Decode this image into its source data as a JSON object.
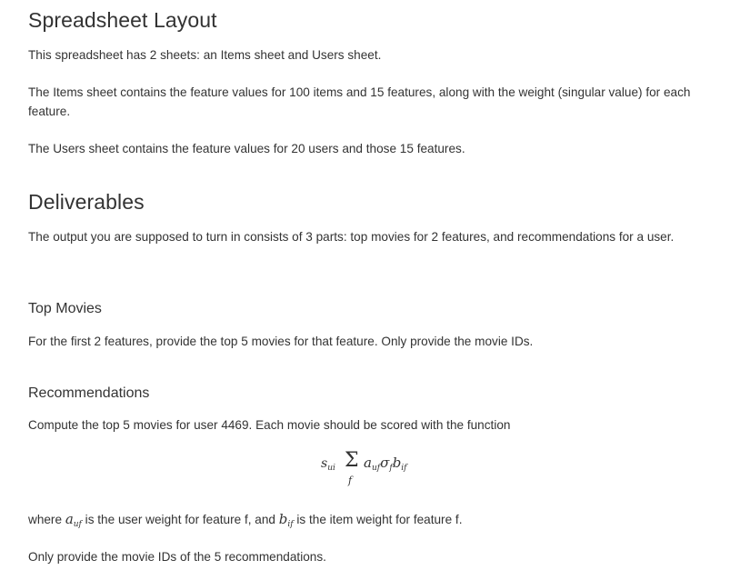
{
  "layout_section": {
    "heading": "Spreadsheet Layout",
    "para1": "This spreadsheet has 2 sheets: an Items sheet and Users sheet.",
    "para2": "The Items sheet contains the feature values for 100 items and 15 features, along with the weight (singular value) for each feature.",
    "para3": "The Users sheet contains the feature values for 20 users and those 15 features."
  },
  "deliverables_section": {
    "heading": "Deliverables",
    "para1": "The output you are supposed to turn in consists of 3 parts: top movies for 2 features, and recommendations for a user."
  },
  "top_movies_section": {
    "heading": "Top Movies",
    "para1": "For the first 2 features, provide the top 5 movies for that feature. Only provide the movie IDs."
  },
  "recommendations_section": {
    "heading": "Recommendations",
    "para1": "Compute the top 5 movies for user 4469. Each movie should be scored with the function",
    "formula": {
      "s": "s",
      "s_sub": "ui",
      "sigma": "Σ",
      "sum_index": "f",
      "a": "a",
      "a_sub": "uf",
      "sigma_f": "σ",
      "sigma_f_sub": "f",
      "b": "b",
      "b_sub": "if"
    },
    "where_prefix": "where ",
    "where_a": "a",
    "where_a_sub": "uf",
    "where_mid": " is the user weight for feature f, and ",
    "where_b": "b",
    "where_b_sub": "if",
    "where_suffix": " is the item weight for feature f.",
    "para_last": "Only provide the movie IDs of the 5 recommendations."
  }
}
